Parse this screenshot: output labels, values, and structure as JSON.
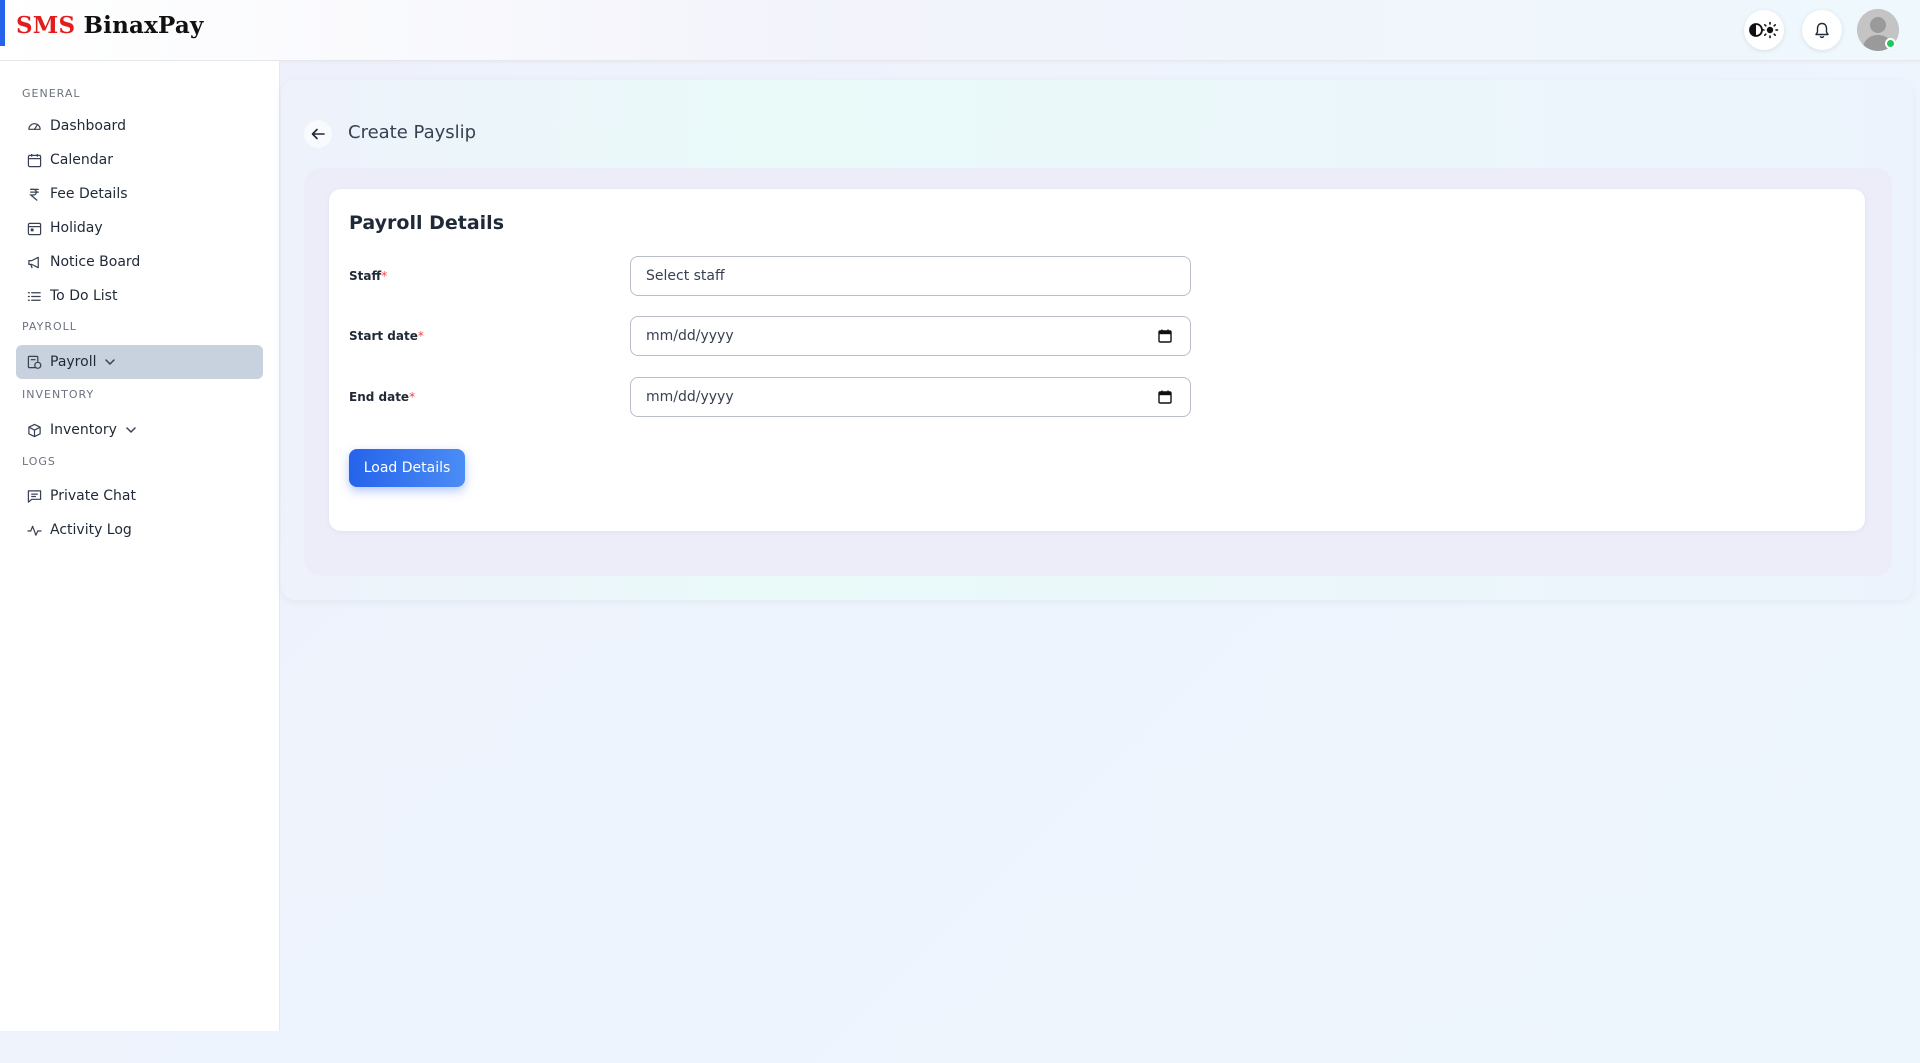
{
  "header": {
    "brand_prefix": "SMS",
    "brand_name": "BinaxPay",
    "theme_icon": "contrast-sun-icon",
    "bell_icon": "bell-icon",
    "avatar_status_color": "#22c55e"
  },
  "sidebar": {
    "sections": {
      "general": "GENERAL",
      "payroll": "PAYROLL",
      "inventory": "INVENTORY",
      "logs": "LOGS"
    },
    "items": {
      "dashboard": "Dashboard",
      "calendar": "Calendar",
      "fee_details": "Fee Details",
      "holiday": "Holiday",
      "notice_board": "Notice Board",
      "todo": "To Do List",
      "payroll": "Payroll",
      "inventory": "Inventory",
      "private_chat": "Private Chat",
      "activity_log": "Activity Log"
    }
  },
  "page": {
    "title": "Create Payslip",
    "card_title": "Payroll Details",
    "fields": {
      "staff_label": "Staff",
      "staff_placeholder": "Select staff",
      "start_label": "Start date",
      "start_placeholder": "mm/dd/yyyy",
      "end_label": "End date",
      "end_placeholder": "mm/dd/yyyy",
      "required_mark": "*"
    },
    "load_button": "Load Details"
  },
  "colors": {
    "accent": "#2563eb",
    "brand_red": "#e11d1d",
    "active_nav": "#c8d1de"
  }
}
